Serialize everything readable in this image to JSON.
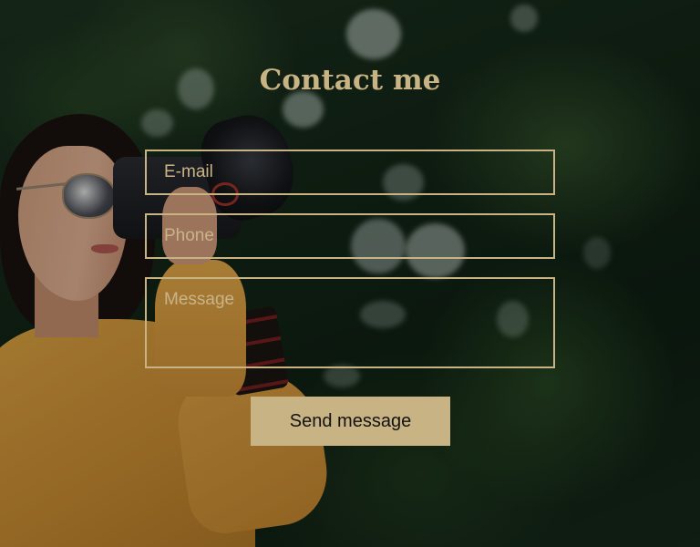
{
  "form": {
    "title": "Contact me",
    "email_placeholder": "E-mail",
    "phone_placeholder": "Phone",
    "message_placeholder": "Message",
    "submit_label": "Send message"
  },
  "colors": {
    "accent": "#c7b384",
    "button_text": "#151310"
  }
}
